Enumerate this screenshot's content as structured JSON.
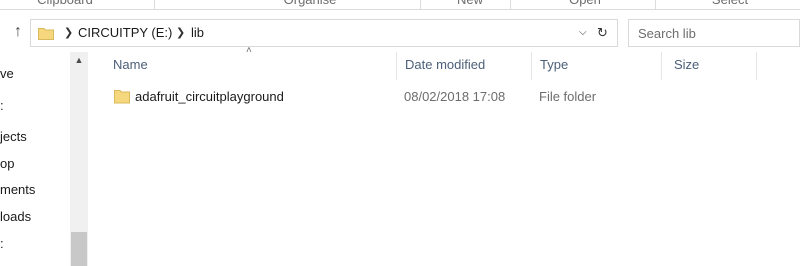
{
  "ribbon": {
    "groups": [
      "Clipboard",
      "Organise",
      "New",
      "Open",
      "Select"
    ]
  },
  "address": {
    "path": [
      "CIRCUITPY (E:)",
      "lib"
    ],
    "search_placeholder": "Search lib"
  },
  "nav": {
    "items": [
      "ve",
      ":",
      "jects",
      "op",
      "ments",
      "loads",
      ":"
    ]
  },
  "columns": {
    "name": "Name",
    "date": "Date modified",
    "type": "Type",
    "size": "Size"
  },
  "files": [
    {
      "name": "adafruit_circuitplayground",
      "date": "08/02/2018 17:08",
      "type": "File folder",
      "size": ""
    }
  ],
  "colors": {
    "folder": "#f5d77e",
    "header_text": "#4c607a",
    "border": "#d9d9d9"
  }
}
